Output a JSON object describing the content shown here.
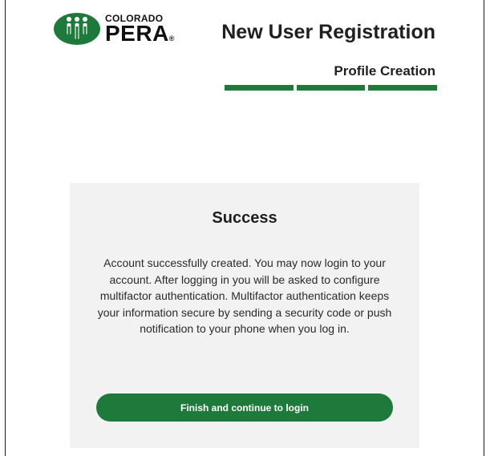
{
  "brand": {
    "small": "COLORADO",
    "big": "PERA",
    "trademark": "®",
    "icon": "colorado-pera-logo-icon",
    "color": "#1e7a3a"
  },
  "header": {
    "title": "New User Registration",
    "step": "Profile Creation",
    "progress": {
      "completed_steps": 3,
      "total_steps": 3,
      "color": "#1e7a3a"
    }
  },
  "panel": {
    "title": "Success",
    "message": "Account successfully created. You may now login to your account. After logging in you will be asked to configure multifactor authentication. Multifactor authentication keeps your information secure by sending a security code or push notification to your phone when you log in.",
    "background": "#f2f2f2"
  },
  "actions": {
    "finish_label": "Finish and continue to login",
    "color": "#1e7a3a"
  }
}
